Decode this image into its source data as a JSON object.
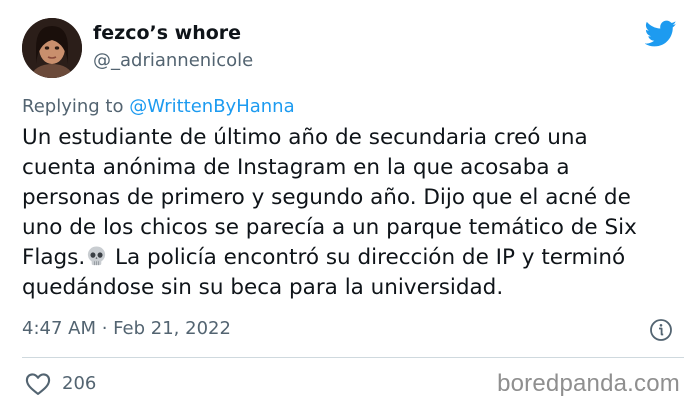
{
  "author": {
    "display_name": "fezco’s whore",
    "handle": "@_adriannenicole",
    "avatar_icon": "user-avatar"
  },
  "header": {
    "brand_icon": "twitter-bird-icon",
    "brand_color": "#1d9bf0"
  },
  "reply": {
    "prefix": "Replying to",
    "mention": "@WrittenByHanna"
  },
  "tweet": {
    "text_part1": "Un estudiante de último año de secundaria creó una\ncuenta anónima de Instagram en la que acosaba a\npersonas de primero y segundo año. Dijo que el acné de\nuno de los chicos se parecía a un parque temático de Six\nFlags.",
    "emoji_icon": "skull-emoji",
    "text_part2": " La policía encontró su dirección de IP y terminó\nquedándose sin su beca para la universidad."
  },
  "meta": {
    "time": "4:47 AM",
    "separator": " · ",
    "date": "Feb 21, 2022",
    "info_icon": "info-icon"
  },
  "engagement": {
    "like_icon": "heart-icon",
    "like_count": "206"
  },
  "watermark": {
    "text": "boredpanda.com"
  },
  "colors": {
    "text_primary": "#0f1419",
    "text_secondary": "#536471",
    "accent": "#1d9bf0",
    "divider": "#cfd9de"
  }
}
